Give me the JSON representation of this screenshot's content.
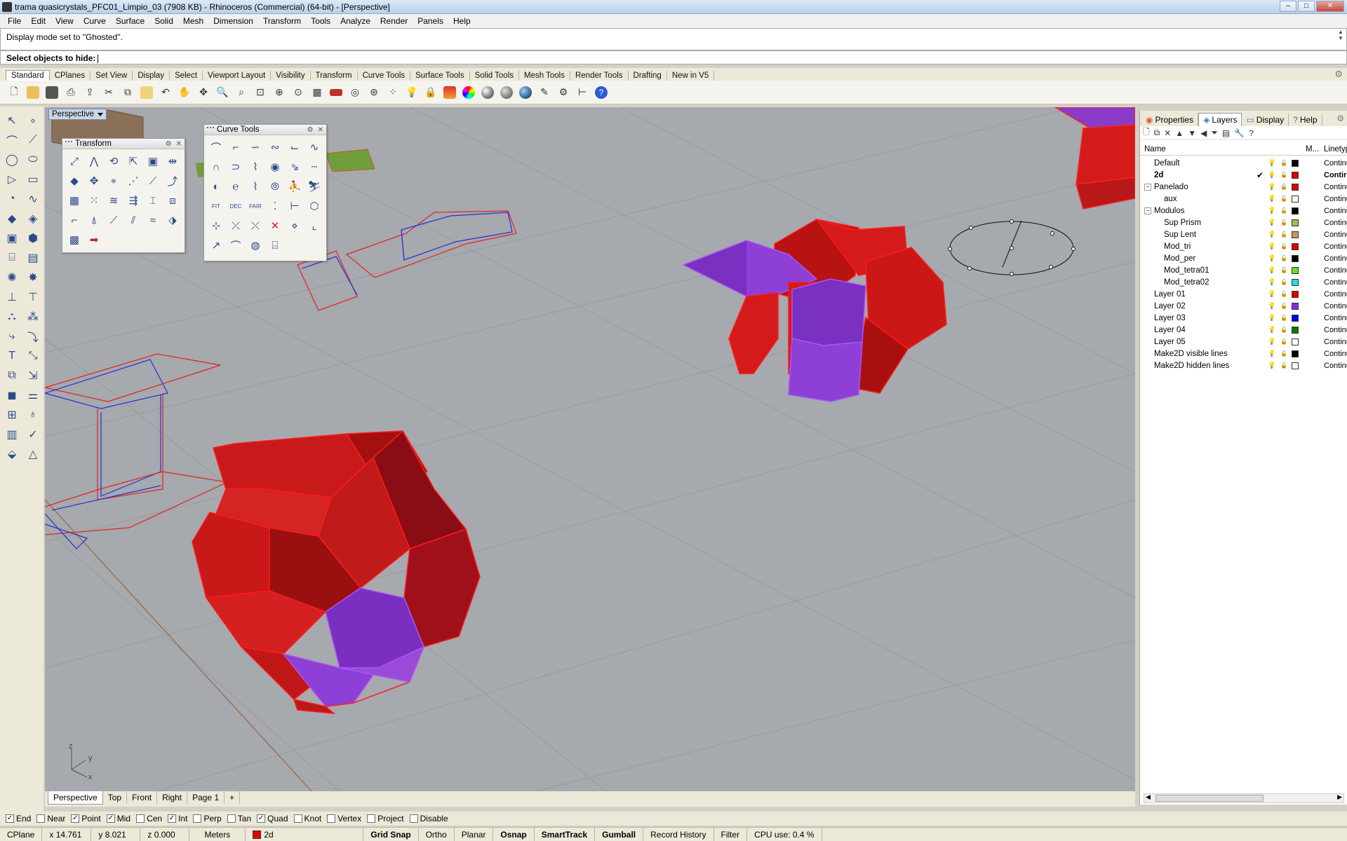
{
  "window": {
    "title": "trama quasicrystals_PFC01_Limpio_03 (7908 KB) - Rhinoceros (Commercial) (64-bit) - [Perspective]"
  },
  "menu": [
    "File",
    "Edit",
    "View",
    "Curve",
    "Surface",
    "Solid",
    "Mesh",
    "Dimension",
    "Transform",
    "Tools",
    "Analyze",
    "Render",
    "Panels",
    "Help"
  ],
  "command": {
    "history": "Display mode set to \"Ghosted\".",
    "prompt": "Select objects to hide:"
  },
  "toolbar_tabs": [
    "Standard",
    "CPlanes",
    "Set View",
    "Display",
    "Select",
    "Viewport Layout",
    "Visibility",
    "Transform",
    "Curve Tools",
    "Surface Tools",
    "Solid Tools",
    "Mesh Tools",
    "Render Tools",
    "Drafting",
    "New in V5"
  ],
  "viewport": {
    "name": "Perspective",
    "axes": {
      "z": "z",
      "y": "y",
      "x": "x"
    }
  },
  "floating": {
    "transform_title": "Transform",
    "curve_tools_title": "Curve Tools"
  },
  "viewport_tabs": [
    "Perspective",
    "Top",
    "Front",
    "Right",
    "Page 1"
  ],
  "panel": {
    "tabs": [
      "Properties",
      "Layers",
      "Display",
      "Help"
    ],
    "columns": {
      "name": "Name",
      "material": "M...",
      "linetype": "Linetyp"
    },
    "layers": [
      {
        "name": "Default",
        "indent": 0,
        "color": "#000000",
        "linetype": "Continu",
        "current": false
      },
      {
        "name": "2d",
        "indent": 0,
        "color": "#e00000",
        "linetype": "Contir",
        "current": true,
        "check": "✔"
      },
      {
        "name": "Panelado",
        "indent": 0,
        "color": "#e00000",
        "linetype": "Continu",
        "expand": "⊟"
      },
      {
        "name": "aux",
        "indent": 1,
        "color": "#ffffff",
        "linetype": "Continu"
      },
      {
        "name": "Modulos",
        "indent": 0,
        "color": "#000000",
        "linetype": "Continu",
        "expand": "⊟"
      },
      {
        "name": "Sup Prism",
        "indent": 1,
        "color": "#9bbb59",
        "linetype": "Continu"
      },
      {
        "name": "Sup Lent",
        "indent": 1,
        "color": "#c8955c",
        "linetype": "Continu"
      },
      {
        "name": "Mod_tri",
        "indent": 1,
        "color": "#e00000",
        "linetype": "Continu"
      },
      {
        "name": "Mod_per",
        "indent": 1,
        "color": "#000000",
        "linetype": "Continu"
      },
      {
        "name": "Mod_tetra01",
        "indent": 1,
        "color": "#66dd22",
        "linetype": "Continu"
      },
      {
        "name": "Mod_tetra02",
        "indent": 1,
        "color": "#22dddd",
        "linetype": "Continu"
      },
      {
        "name": "Layer 01",
        "indent": 0,
        "color": "#e00000",
        "linetype": "Continu"
      },
      {
        "name": "Layer 02",
        "indent": 0,
        "color": "#8a2be2",
        "linetype": "Continu"
      },
      {
        "name": "Layer 03",
        "indent": 0,
        "color": "#0000ee",
        "linetype": "Continu"
      },
      {
        "name": "Layer 04",
        "indent": 0,
        "color": "#008000",
        "linetype": "Continu"
      },
      {
        "name": "Layer 05",
        "indent": 0,
        "color": "#ffffff",
        "linetype": "Continu"
      },
      {
        "name": "Make2D visible lines",
        "indent": 0,
        "color": "#000000",
        "linetype": "Continu"
      },
      {
        "name": "Make2D hidden lines",
        "indent": 0,
        "color": "#ffffff",
        "linetype": "Continu"
      }
    ]
  },
  "osnaps": [
    {
      "label": "End",
      "checked": true
    },
    {
      "label": "Near",
      "checked": false
    },
    {
      "label": "Point",
      "checked": true
    },
    {
      "label": "Mid",
      "checked": true
    },
    {
      "label": "Cen",
      "checked": false
    },
    {
      "label": "Int",
      "checked": true
    },
    {
      "label": "Perp",
      "checked": false
    },
    {
      "label": "Tan",
      "checked": false
    },
    {
      "label": "Quad",
      "checked": true
    },
    {
      "label": "Knot",
      "checked": false
    },
    {
      "label": "Vertex",
      "checked": false
    },
    {
      "label": "Project",
      "checked": false
    },
    {
      "label": "Disable",
      "checked": false
    }
  ],
  "status": {
    "cplane": "CPlane",
    "x": "x 14.761",
    "y": "y 8.021",
    "z": "z 0.000",
    "units": "Meters",
    "layer": "2d",
    "layer_color": "#e00000",
    "toggles": [
      {
        "label": "Grid Snap",
        "bold": true
      },
      {
        "label": "Ortho",
        "bold": false
      },
      {
        "label": "Planar",
        "bold": false
      },
      {
        "label": "Osnap",
        "bold": true
      },
      {
        "label": "SmartTrack",
        "bold": true
      },
      {
        "label": "Gumball",
        "bold": true
      },
      {
        "label": "Record History",
        "bold": false
      },
      {
        "label": "Filter",
        "bold": false
      }
    ],
    "cpu": "CPU use: 0.4 %"
  }
}
